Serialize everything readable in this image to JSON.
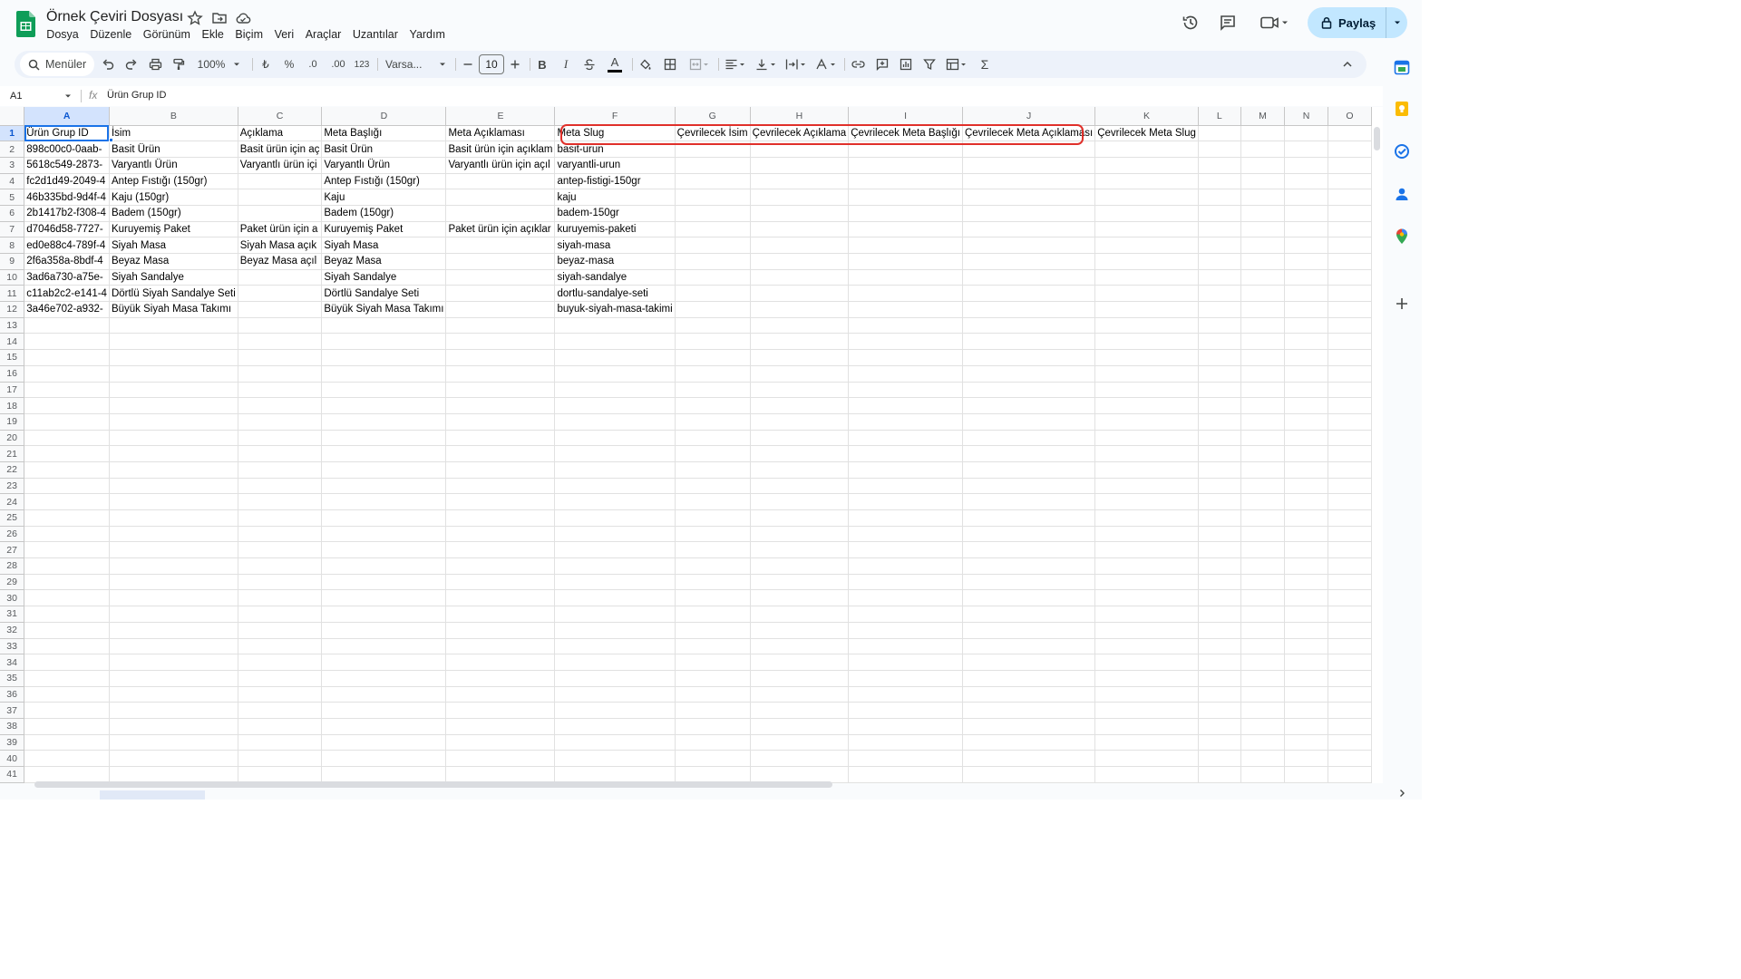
{
  "doc": {
    "title": "Örnek Çeviri Dosyası"
  },
  "menu": [
    "Dosya",
    "Düzenle",
    "Görünüm",
    "Ekle",
    "Biçim",
    "Veri",
    "Araçlar",
    "Uzantılar",
    "Yardım"
  ],
  "share": {
    "label": "Paylaş"
  },
  "toolbar": {
    "search_label": "Menüler",
    "zoom": "100%",
    "currency": "₺",
    "percent": "%",
    "dec_decrease": ".0",
    "dec_increase": ".00",
    "number_format": "123",
    "font": "Varsa...",
    "font_size": "10",
    "bold": "B",
    "italic": "I",
    "text_color_glyph": "A",
    "sum_glyph": "Σ"
  },
  "formula_bar": {
    "cell_ref": "A1",
    "fx": "fx",
    "content": "Ürün Grup ID"
  },
  "columns": [
    "A",
    "B",
    "C",
    "D",
    "E",
    "F",
    "G",
    "H",
    "I",
    "J",
    "K",
    "L",
    "M",
    "N",
    "O"
  ],
  "row_numbers": [
    "1",
    "2",
    "3",
    "4",
    "5",
    "6",
    "7",
    "8",
    "9",
    "10",
    "11",
    "12",
    "13",
    "14",
    "15",
    "16",
    "17",
    "18",
    "19",
    "20",
    "21",
    "22",
    "23",
    "24",
    "25",
    "26",
    "27",
    "28",
    "29",
    "30",
    "31",
    "32",
    "33",
    "34",
    "35",
    "36",
    "37",
    "38",
    "39",
    "40",
    "41"
  ],
  "rows": [
    [
      "Ürün Grup ID",
      "İsim",
      "Açıklama",
      "Meta Başlığı",
      "Meta Açıklaması",
      "Meta Slug",
      "Çevrilecek İsim",
      "Çevrilecek Açıklama",
      "Çevrilecek Meta Başlığı",
      "Çevrilecek Meta Açıklaması",
      "Çevrilecek Meta Slug",
      "",
      "",
      "",
      ""
    ],
    [
      "898c00c0-0aab-",
      "Basit Ürün",
      "Basit ürün için aç",
      "Basit Ürün",
      "Basit ürün için açıklam",
      "basit-urun",
      "",
      "",
      "",
      "",
      "",
      "",
      "",
      "",
      ""
    ],
    [
      "5618c549-2873-",
      "Varyantlı Ürün",
      "Varyantlı ürün içi",
      "Varyantlı Ürün",
      "Varyantlı ürün için açıl",
      "varyantli-urun",
      "",
      "",
      "",
      "",
      "",
      "",
      "",
      "",
      ""
    ],
    [
      "fc2d1d49-2049-4",
      "Antep Fıstığı (150gr)",
      "",
      "Antep Fıstığı (150gr)",
      "",
      "antep-fistigi-150gr",
      "",
      "",
      "",
      "",
      "",
      "",
      "",
      "",
      ""
    ],
    [
      "46b335bd-9d4f-4",
      "Kaju (150gr)",
      "",
      "Kaju",
      "",
      "kaju",
      "",
      "",
      "",
      "",
      "",
      "",
      "",
      "",
      ""
    ],
    [
      "2b1417b2-f308-4",
      "Badem (150gr)",
      "",
      "Badem (150gr)",
      "",
      "badem-150gr",
      "",
      "",
      "",
      "",
      "",
      "",
      "",
      "",
      ""
    ],
    [
      "d7046d58-7727-",
      "Kuruyemiş Paket",
      "Paket ürün için a",
      "Kuruyemiş Paket",
      "Paket ürün için açıklar",
      "kuruyemis-paketi",
      "",
      "",
      "",
      "",
      "",
      "",
      "",
      "",
      ""
    ],
    [
      "ed0e88c4-789f-4",
      "Siyah Masa",
      "Siyah Masa açık",
      "Siyah Masa",
      "",
      "siyah-masa",
      "",
      "",
      "",
      "",
      "",
      "",
      "",
      "",
      ""
    ],
    [
      "2f6a358a-8bdf-4",
      "Beyaz Masa",
      "Beyaz Masa açıl",
      "Beyaz Masa",
      "",
      "beyaz-masa",
      "",
      "",
      "",
      "",
      "",
      "",
      "",
      "",
      ""
    ],
    [
      "3ad6a730-a75e-",
      "Siyah Sandalye",
      "",
      "Siyah Sandalye",
      "",
      "siyah-sandalye",
      "",
      "",
      "",
      "",
      "",
      "",
      "",
      "",
      ""
    ],
    [
      "c11ab2c2-e141-4",
      "Dörtlü Siyah Sandalye Seti",
      "",
      "Dörtlü Sandalye Seti",
      "",
      "dortlu-sandalye-seti",
      "",
      "",
      "",
      "",
      "",
      "",
      "",
      "",
      ""
    ],
    [
      "3a46e702-a932-",
      "Büyük Siyah Masa Takımı",
      "",
      "Büyük Siyah Masa Takımı",
      "",
      "buyuk-siyah-masa-takimi",
      "",
      "",
      "",
      "",
      "",
      "",
      "",
      "",
      ""
    ]
  ],
  "colors": {
    "accent": "#1a73e8",
    "share_bg": "#c2e7ff",
    "annotation": "#e0302a",
    "sheets_green": "#0f9d58"
  }
}
